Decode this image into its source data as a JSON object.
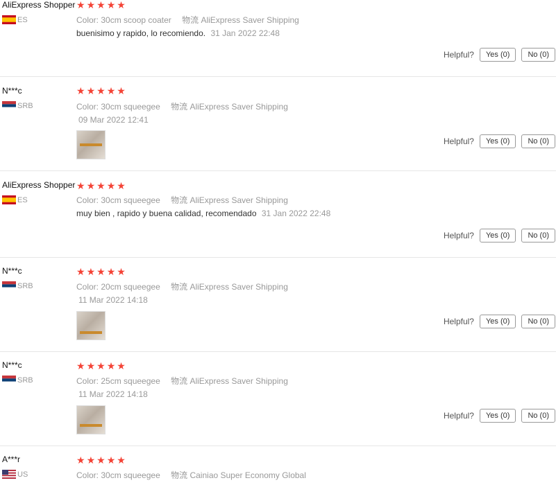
{
  "reviews": [
    {
      "name": "AliExpress Shopper",
      "country": "ES",
      "flag": "es",
      "color_label": "Color:",
      "color_value": "30cm scoop coater",
      "ship_label": "物流",
      "ship_value": "AliExpress Saver Shipping",
      "content": "buenisimo y rapido, lo recomiendo.",
      "date": "31 Jan 2022 22:48",
      "has_image": false
    },
    {
      "name": "N***c",
      "country": "SRB",
      "flag": "rs",
      "color_label": "Color:",
      "color_value": "30cm squeegee",
      "ship_label": "物流",
      "ship_value": "AliExpress Saver Shipping",
      "content": "",
      "date": "09 Mar 2022 12:41",
      "has_image": true
    },
    {
      "name": "AliExpress Shopper",
      "country": "ES",
      "flag": "es",
      "color_label": "Color:",
      "color_value": "30cm squeegee",
      "ship_label": "物流",
      "ship_value": "AliExpress Saver Shipping",
      "content": "muy bien , rapido y buena calidad, recomendado",
      "date": "31 Jan 2022 22:48",
      "has_image": false
    },
    {
      "name": "N***c",
      "country": "SRB",
      "flag": "rs",
      "color_label": "Color:",
      "color_value": "20cm squeegee",
      "ship_label": "物流",
      "ship_value": "AliExpress Saver Shipping",
      "content": "",
      "date": "11 Mar 2022 14:18",
      "has_image": true
    },
    {
      "name": "N***c",
      "country": "SRB",
      "flag": "rs",
      "color_label": "Color:",
      "color_value": "25cm squeegee",
      "ship_label": "物流",
      "ship_value": "AliExpress Saver Shipping",
      "content": "",
      "date": "11 Mar 2022 14:18",
      "has_image": true
    },
    {
      "name": "A***r",
      "country": "US",
      "flag": "us",
      "color_label": "Color:",
      "color_value": "30cm squeegee",
      "ship_label": "物流",
      "ship_value": "Cainiao Super Economy Global",
      "content": "",
      "date": "",
      "has_image": false
    }
  ],
  "helpful": {
    "label": "Helpful?",
    "yes": "Yes (0)",
    "no": "No (0)"
  },
  "rating": {
    "stars": 5,
    "max": 5
  },
  "colors": {
    "star": "#f44336",
    "muted": "#999999"
  }
}
